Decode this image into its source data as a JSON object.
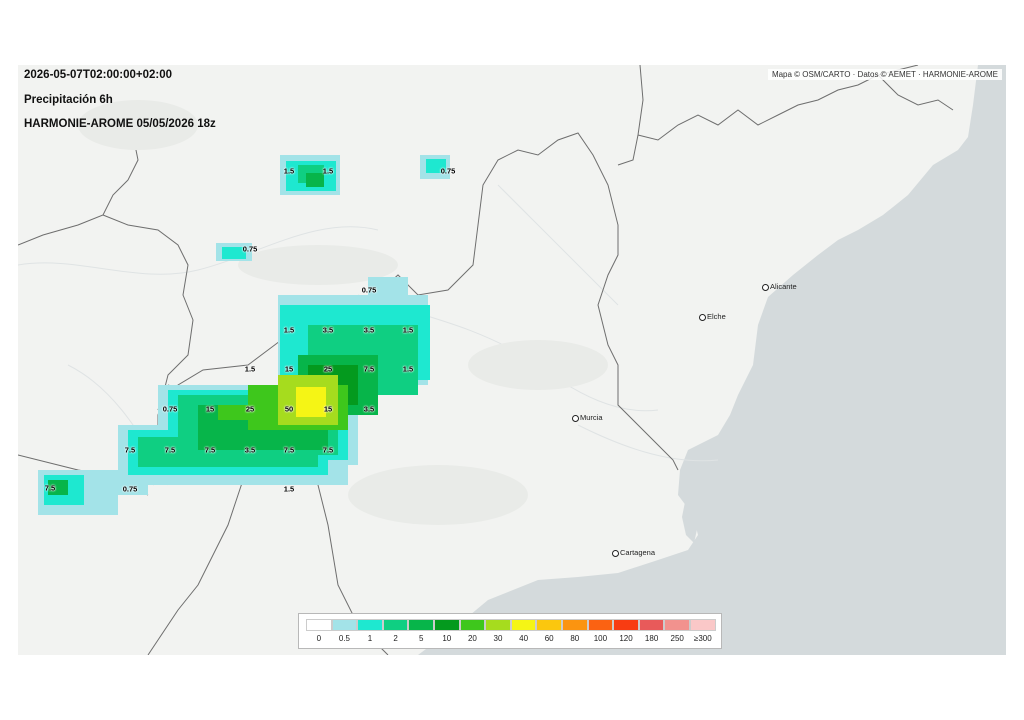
{
  "header": {
    "valid_time": "2026-05-07T02:00:00+02:00",
    "variable": "Precipitación 6h",
    "model_run": "HARMONIE-AROME 05/05/2026 18z"
  },
  "attribution": "Mapa © OSM/CARTO · Datos © AEMET · HARMONIE-AROME",
  "cities": [
    {
      "name": "Alicante"
    },
    {
      "name": "Elche"
    },
    {
      "name": "Murcia"
    },
    {
      "name": "Cartagena"
    }
  ],
  "value_labels": [
    "1.5",
    "1.5",
    "0.75",
    "0.75",
    "0.75",
    "1.5",
    "3.5",
    "3.5",
    "1.5",
    "1.5",
    "15",
    "25",
    "7.5",
    "1.5",
    "0.75",
    "15",
    "25",
    "50",
    "15",
    "3.5",
    "7.5",
    "7.5",
    "7.5",
    "3.5",
    "7.5",
    "7.5",
    "7.5",
    "0.75",
    "1.5"
  ],
  "legend": {
    "labels": [
      "0",
      "0.5",
      "1",
      "2",
      "5",
      "10",
      "20",
      "30",
      "40",
      "60",
      "80",
      "100",
      "120",
      "180",
      "250",
      "≥300"
    ],
    "colors": [
      "#ffffff",
      "#a3e3e8",
      "#1ee8d0",
      "#0fcf82",
      "#07b54a",
      "#049a1e",
      "#3ec71c",
      "#a6dc1e",
      "#f5f515",
      "#fbc70e",
      "#fb9410",
      "#fb6212",
      "#f83c12",
      "#e85a5a",
      "#f2928e",
      "#fac8c8"
    ]
  },
  "colors": {
    "sea": "#d4dadc",
    "land": "#f2f3f1",
    "border": "#6e6e6e"
  }
}
